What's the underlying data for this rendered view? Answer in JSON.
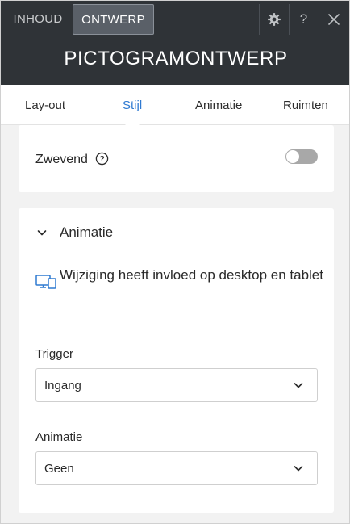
{
  "header": {
    "tabs": [
      {
        "label": "INHOUD",
        "active": false
      },
      {
        "label": "ONTWERP",
        "active": true
      }
    ],
    "help_label": "?",
    "title": "PICTOGRAMONTWERP",
    "icons": [
      "gear-icon",
      "help-icon",
      "close-icon"
    ]
  },
  "sub_tabs": [
    {
      "label": "Lay-out",
      "active": false
    },
    {
      "label": "Stijl",
      "active": true
    },
    {
      "label": "Animatie",
      "active": false
    },
    {
      "label": "Ruimten",
      "active": false
    }
  ],
  "floating": {
    "label": "Zwevend",
    "enabled": false
  },
  "animation_section": {
    "title": "Animatie",
    "expanded": true,
    "notice": "Wijziging heeft invloed op desktop en tablet",
    "trigger": {
      "label": "Trigger",
      "value": "Ingang"
    },
    "animation": {
      "label": "Animatie",
      "value": "Geen"
    }
  },
  "colors": {
    "header_bg": "#2f3337",
    "accent": "#2f7ad1",
    "panel_bg": "#f2f2f2",
    "toggle_off": "#a8a8a8"
  }
}
